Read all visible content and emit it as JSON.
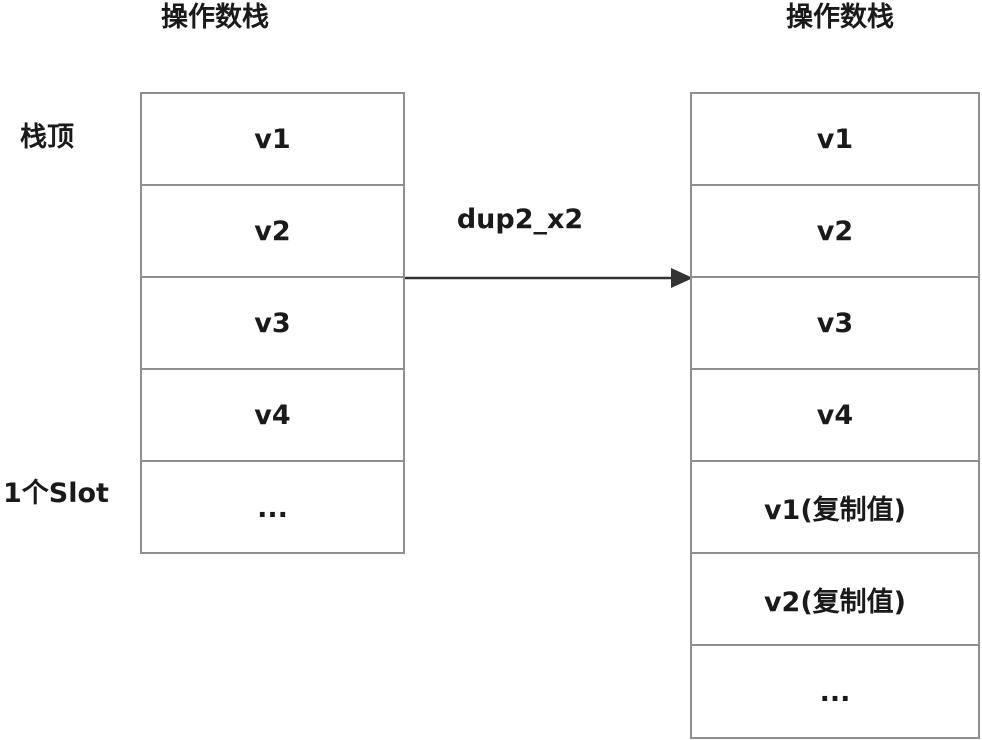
{
  "left_stack": {
    "title": "操作数栈",
    "top_label": "栈顶",
    "slot_label": "1个Slot",
    "cells": [
      "v1",
      "v2",
      "v3",
      "v4",
      "..."
    ]
  },
  "right_stack": {
    "title": "操作数栈",
    "cells": [
      "v1",
      "v2",
      "v3",
      "v4",
      "v1(复制值)",
      "v2(复制值)",
      "..."
    ]
  },
  "arrow": {
    "label": "dup2_x2"
  }
}
